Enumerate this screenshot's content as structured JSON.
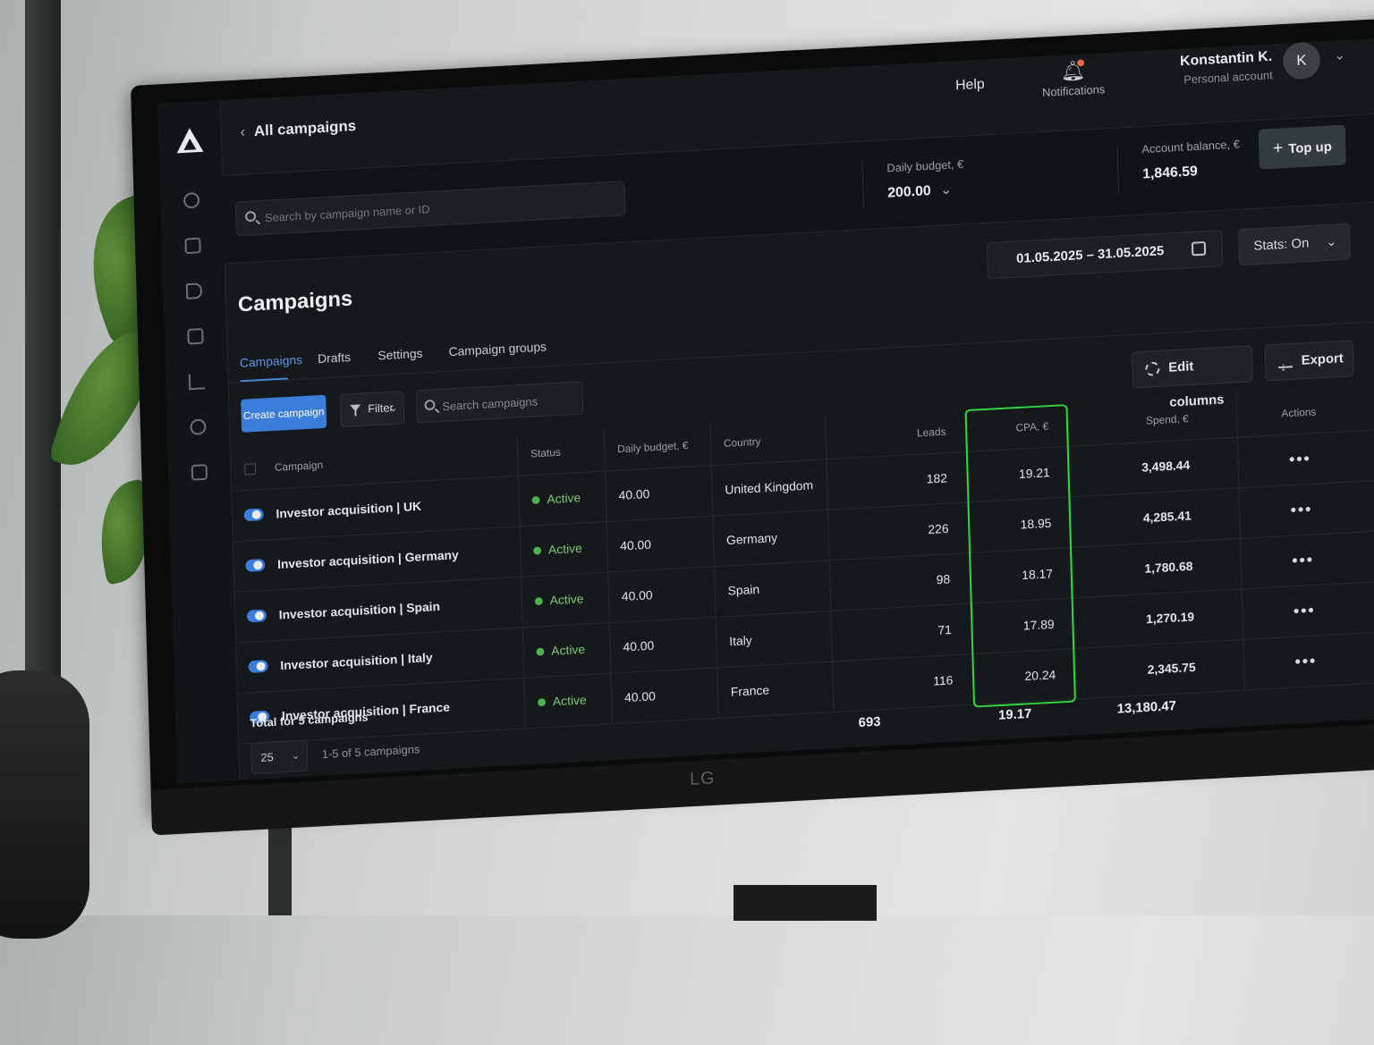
{
  "app": {
    "breadcrumb": "All campaigns",
    "help": "Help",
    "notifications": "Notifications",
    "user": {
      "name": "Konstantin K.",
      "subtitle": "Personal account",
      "initial": "K"
    },
    "brand": "LG"
  },
  "summary": {
    "search_placeholder": "Search by campaign name or ID",
    "daily_budget_label": "Daily budget, €",
    "daily_budget_value": "200.00",
    "balance_label": "Account balance, €",
    "balance_value": "1,846.59",
    "topup_label": "Top up"
  },
  "page": {
    "title": "Campaigns",
    "date_range": "01.05.2025 – 31.05.2025",
    "stats_toggle": "Stats: On"
  },
  "tabs": [
    "Campaigns",
    "Drafts",
    "Settings",
    "Campaign groups"
  ],
  "active_tab": "Campaigns",
  "toolbar": {
    "create": "Create campaign",
    "filter": "Filter",
    "search_placeholder": "Search campaigns",
    "edit_columns": "Edit columns",
    "export": "Export"
  },
  "table": {
    "columns": [
      "Campaign",
      "Status",
      "Daily budget, €",
      "Country",
      "Leads",
      "CPA, €",
      "Spend, €",
      "Actions"
    ],
    "rows": [
      {
        "name": "Investor acquisition | UK",
        "status": "Active",
        "budget": "40.00",
        "country": "United Kingdom",
        "leads": "182",
        "cpa": "19.21",
        "spend": "3,498.44",
        "actions": "•••"
      },
      {
        "name": "Investor acquisition | Germany",
        "status": "Active",
        "budget": "40.00",
        "country": "Germany",
        "leads": "226",
        "cpa": "18.95",
        "spend": "4,285.41",
        "actions": "•••"
      },
      {
        "name": "Investor acquisition | Spain",
        "status": "Active",
        "budget": "40.00",
        "country": "Spain",
        "leads": "98",
        "cpa": "18.17",
        "spend": "1,780.68",
        "actions": "•••"
      },
      {
        "name": "Investor acquisition | Italy",
        "status": "Active",
        "budget": "40.00",
        "country": "Italy",
        "leads": "71",
        "cpa": "17.89",
        "spend": "1,270.19",
        "actions": "•••"
      },
      {
        "name": "Investor acquisition | France",
        "status": "Active",
        "budget": "40.00",
        "country": "France",
        "leads": "116",
        "cpa": "20.24",
        "spend": "2,345.75",
        "actions": "•••"
      }
    ],
    "total_label": "Total for 5 campaigns",
    "totals": {
      "leads": "693",
      "cpa": "19.17",
      "spend": "13,180.47"
    },
    "page_size": "25",
    "range_text": "1-5 of 5 campaigns"
  },
  "colors": {
    "accent": "#3b7ddb",
    "active": "#4caf50",
    "highlight": "#31d843"
  },
  "icons": [
    "logo-icon",
    "back-chevron-icon",
    "bell-icon",
    "search-icon",
    "calendar-icon",
    "chevron-down-icon",
    "filter-icon",
    "gear-icon",
    "download-icon",
    "plus-icon"
  ]
}
